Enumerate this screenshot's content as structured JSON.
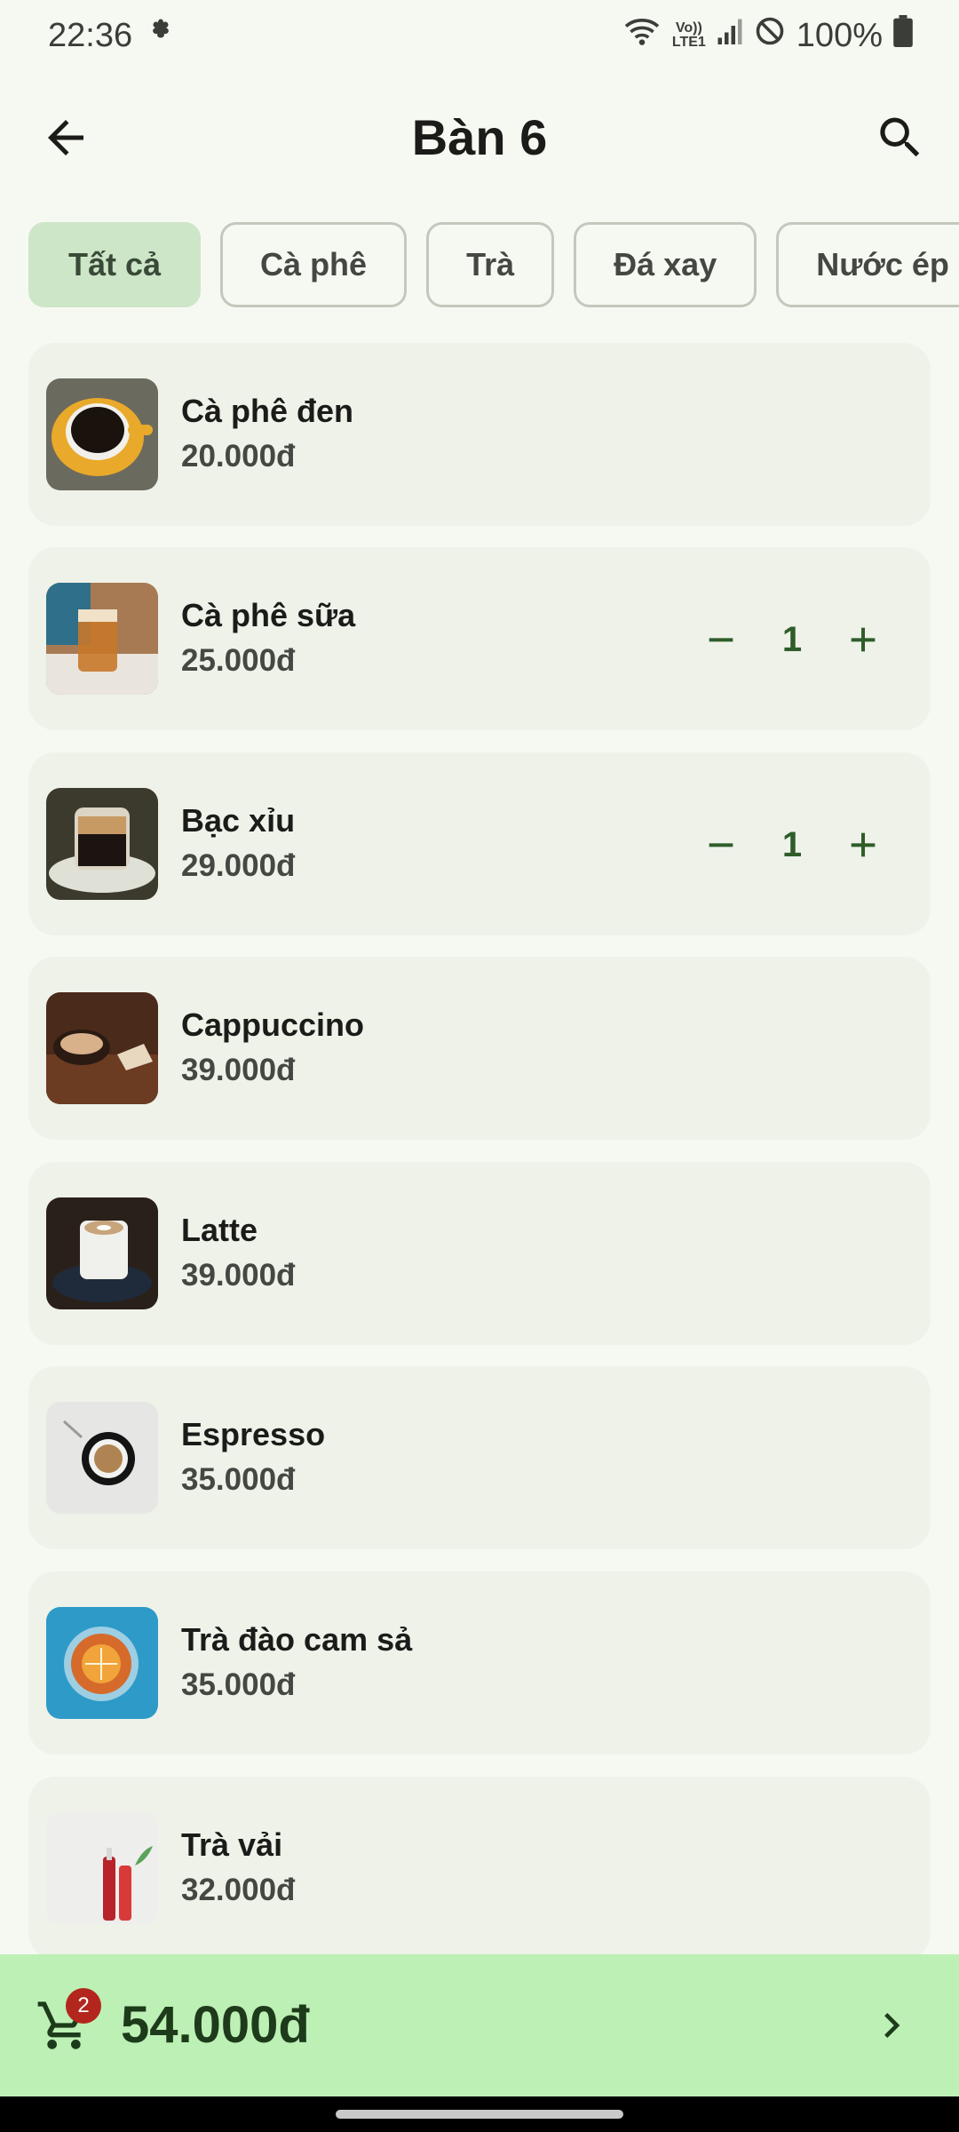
{
  "status": {
    "time": "22:36",
    "signal_top": "Vo))",
    "signal_bottom": "LTE1",
    "battery": "100%"
  },
  "header": {
    "title": "Bàn 6"
  },
  "categories": [
    {
      "label": "Tất cả",
      "active": true
    },
    {
      "label": "Cà phê",
      "active": false
    },
    {
      "label": "Trà",
      "active": false
    },
    {
      "label": "Đá xay",
      "active": false
    },
    {
      "label": "Nước ép & S",
      "active": false
    }
  ],
  "items": [
    {
      "name": "Cà phê đen",
      "price": "20.000đ"
    },
    {
      "name": "Cà phê sữa",
      "price": "25.000đ",
      "qty": "1"
    },
    {
      "name": "Bạc xỉu",
      "price": "29.000đ",
      "qty": "1"
    },
    {
      "name": "Cappuccino",
      "price": "39.000đ"
    },
    {
      "name": "Latte",
      "price": "39.000đ"
    },
    {
      "name": "Espresso",
      "price": "35.000đ"
    },
    {
      "name": "Trà đào cam sả",
      "price": "35.000đ"
    },
    {
      "name": "Trà vải",
      "price": "32.000đ"
    }
  ],
  "cart": {
    "count": "2",
    "total": "54.000đ"
  },
  "colors": {
    "accent": "#2f5d2a",
    "chip_active": "#cde6c8",
    "bottom_bar": "#bdf0b5",
    "badge": "#b3261e"
  }
}
